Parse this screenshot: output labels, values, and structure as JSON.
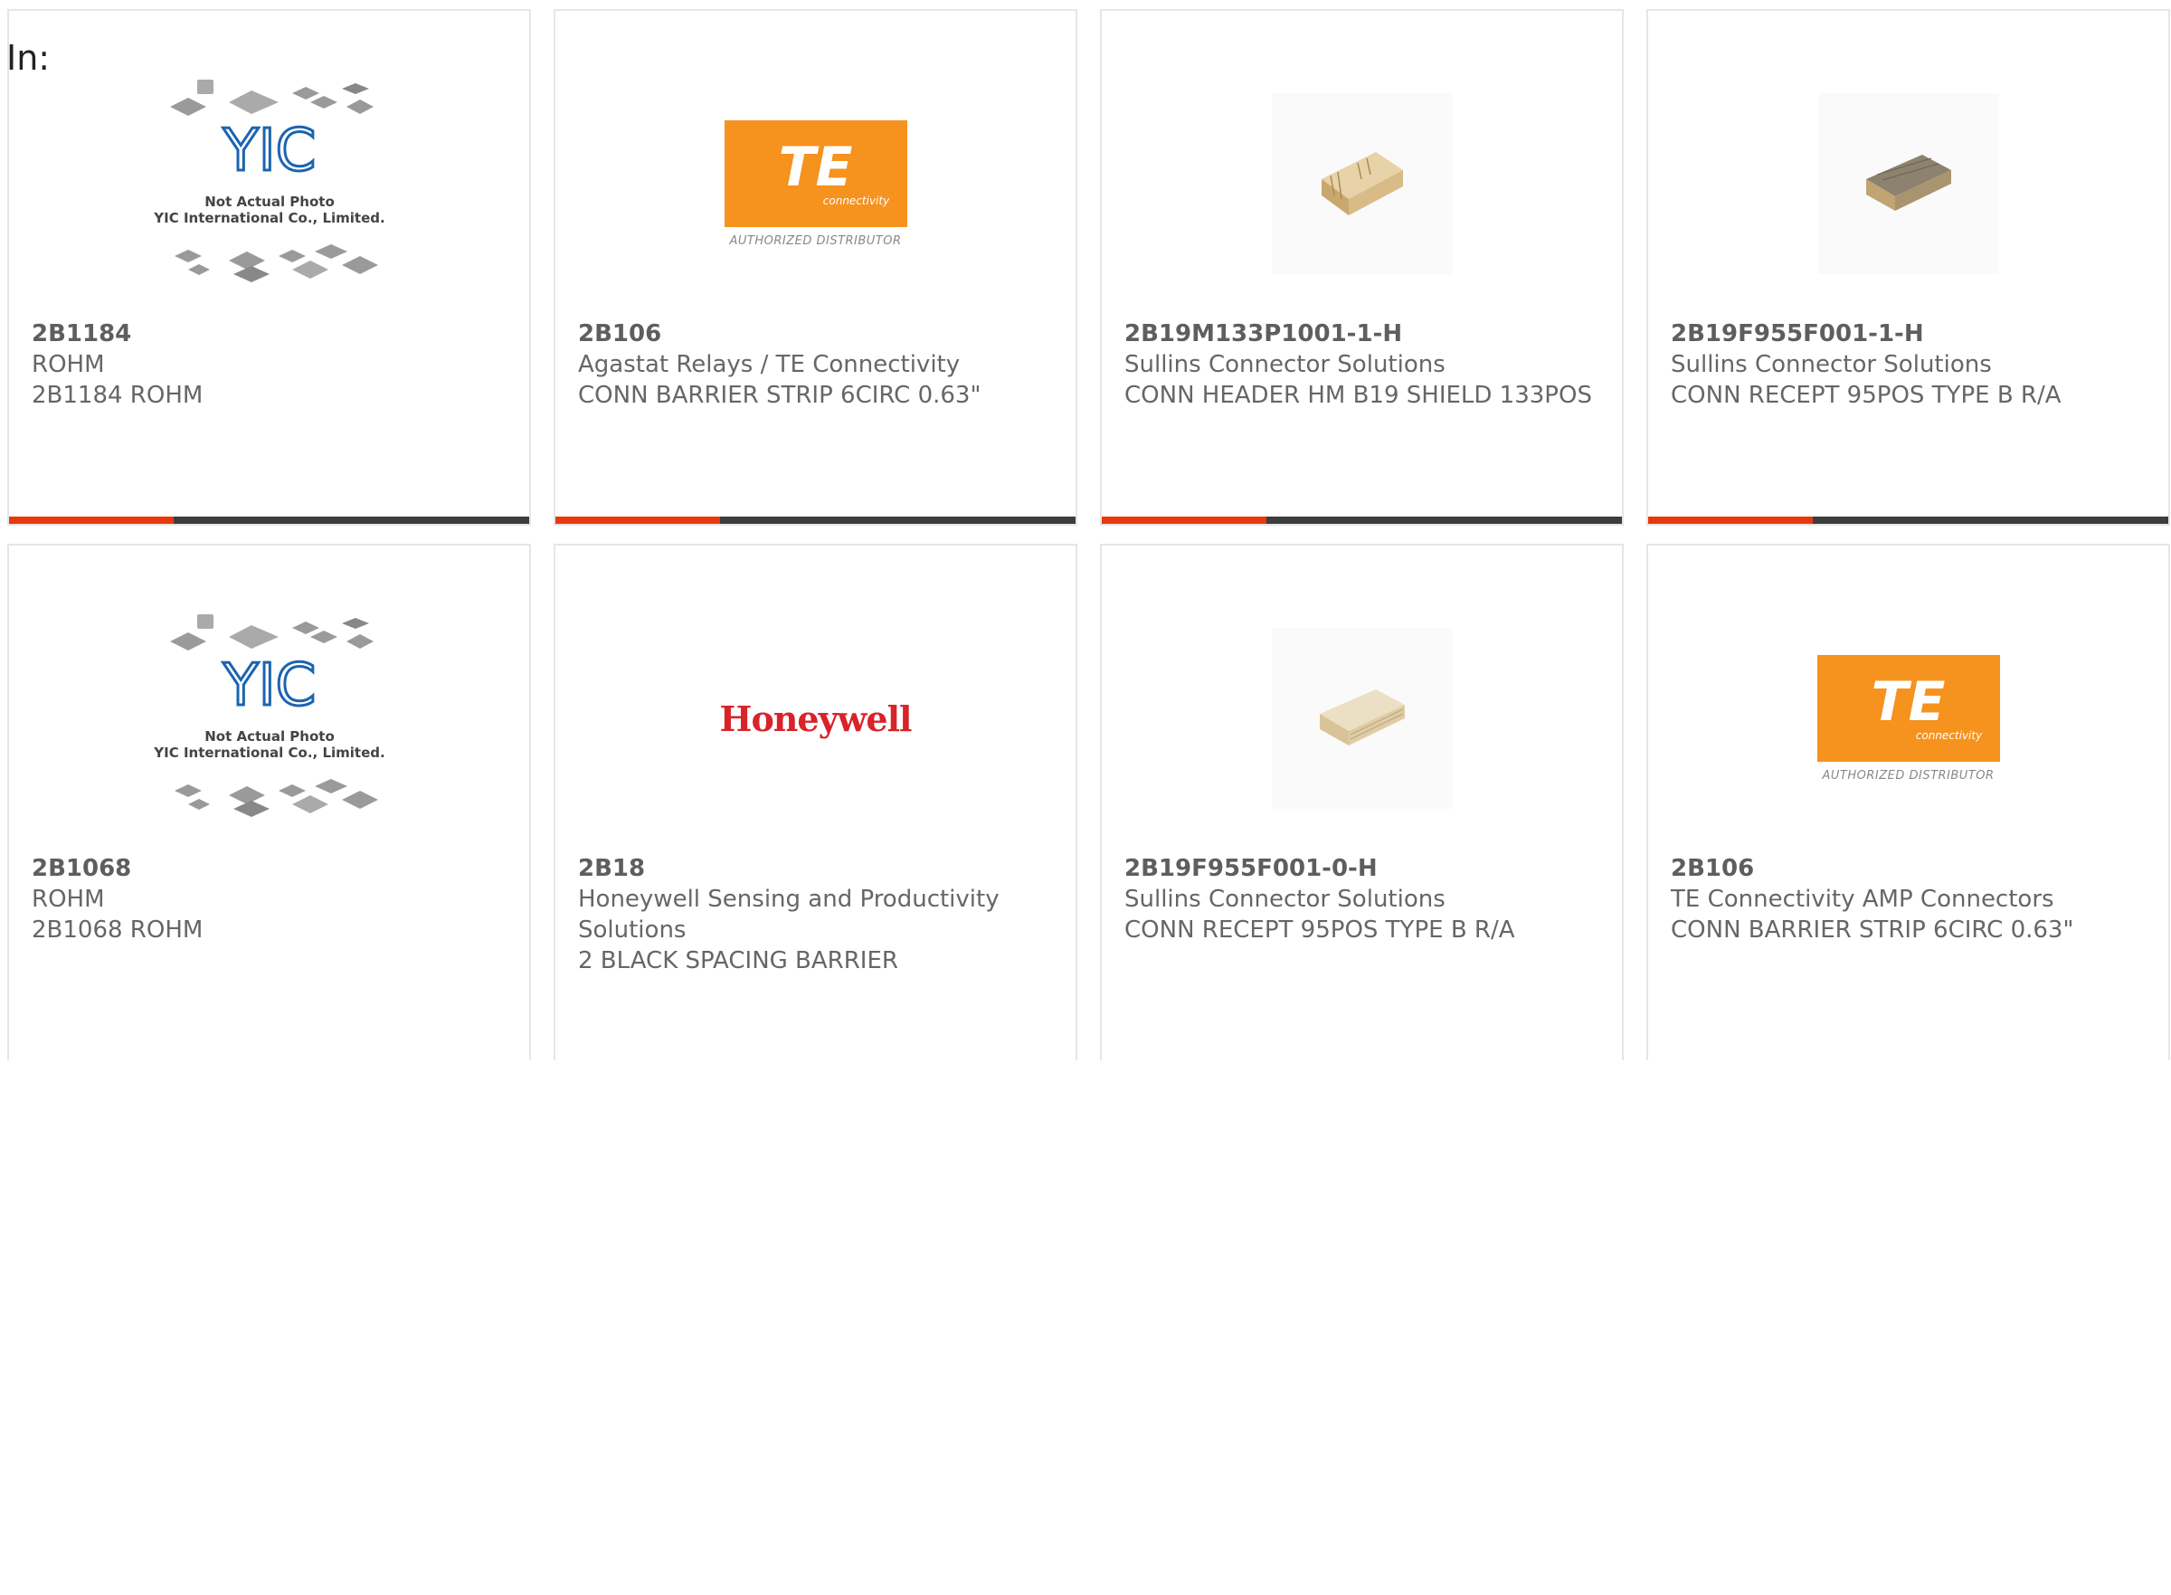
{
  "filter_label": "In:",
  "placeholder_text": [
    "Not Actual Photo",
    "YIC International Co., Limited."
  ],
  "te_logo": {
    "mark": "TE",
    "sub": "connectivity",
    "authorized": "AUTHORIZED DISTRIBUTOR"
  },
  "honeywell_logo": "Honeywell",
  "colors": {
    "accent": "#e8380d",
    "bar": "#3d3d3d",
    "te_orange": "#f6921e",
    "honeywell_red": "#d8232a"
  },
  "products": [
    {
      "part": "2B1184",
      "maker": "ROHM",
      "desc": "2B1184 ROHM",
      "image": "yic-placeholder"
    },
    {
      "part": "2B106",
      "maker": "Agastat Relays / TE Connectivity",
      "desc": "CONN BARRIER STRIP 6CIRC 0.63\"",
      "image": "te-logo"
    },
    {
      "part": "2B19M133P1001-1-H",
      "maker": "Sullins Connector Solutions",
      "desc": "CONN HEADER HM B19 SHIELD 133POS",
      "image": "connector-header"
    },
    {
      "part": "2B19F955F001-1-H",
      "maker": "Sullins Connector Solutions",
      "desc": "CONN RECEPT 95POS TYPE B R/A",
      "image": "connector-receptacle-dark"
    },
    {
      "part": "2B1068",
      "maker": "ROHM",
      "desc": "2B1068 ROHM",
      "image": "yic-placeholder"
    },
    {
      "part": "2B18",
      "maker": "Honeywell Sensing and Productivity Solutions",
      "desc": "2 BLACK SPACING BARRIER",
      "image": "honeywell-logo"
    },
    {
      "part": "2B19F955F001-0-H",
      "maker": "Sullins Connector Solutions",
      "desc": "CONN RECEPT 95POS TYPE B R/A",
      "image": "connector-receptacle-light"
    },
    {
      "part": "2B106",
      "maker": "TE Connectivity AMP Connectors",
      "desc": "CONN BARRIER STRIP 6CIRC 0.63\"",
      "image": "te-logo"
    }
  ]
}
